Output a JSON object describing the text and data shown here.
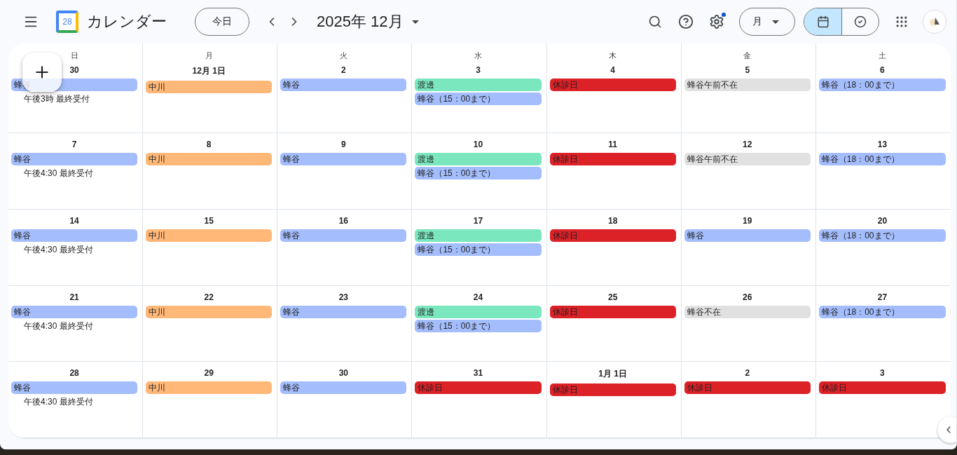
{
  "header": {
    "logo_text": "28",
    "title": "カレンダー",
    "today_button": "今日",
    "period": "2025年 12月",
    "settings_badge": true,
    "view_select": "月",
    "view_toggle": [
      {
        "kind": "calendar",
        "selected": true
      },
      {
        "kind": "tasks",
        "selected": false
      }
    ]
  },
  "weekdays": [
    "日",
    "月",
    "火",
    "水",
    "木",
    "金",
    "土"
  ],
  "weeks": [
    [
      {
        "date": "30",
        "events": [
          {
            "kind": "chip",
            "title": "蜂谷",
            "color": "#a4bdfc"
          },
          {
            "kind": "note",
            "title": "午後3時 最終受付"
          }
        ]
      },
      {
        "date": "12月 1日",
        "events": [
          {
            "kind": "chip",
            "title": "中川",
            "color": "#ffb878"
          }
        ]
      },
      {
        "date": "2",
        "events": [
          {
            "kind": "chip",
            "title": "蜂谷",
            "color": "#a4bdfc"
          }
        ]
      },
      {
        "date": "3",
        "events": [
          {
            "kind": "chip",
            "title": "渡邊",
            "color": "#7ae7bf"
          },
          {
            "kind": "chip",
            "title": "蜂谷（15：00まで）",
            "color": "#a4bdfc"
          }
        ]
      },
      {
        "date": "4",
        "events": [
          {
            "kind": "chip",
            "title": "休診日",
            "color": "#dc2127"
          }
        ]
      },
      {
        "date": "5",
        "events": [
          {
            "kind": "chip",
            "title": "蜂谷午前不在",
            "color": "#e1e1e1"
          }
        ]
      },
      {
        "date": "6",
        "events": [
          {
            "kind": "chip",
            "title": "蜂谷（18：00まで）",
            "color": "#a4bdfc"
          }
        ]
      }
    ],
    [
      {
        "date": "7",
        "events": [
          {
            "kind": "chip",
            "title": "蜂谷",
            "color": "#a4bdfc"
          },
          {
            "kind": "note",
            "title": "午後4:30 最終受付"
          }
        ]
      },
      {
        "date": "8",
        "events": [
          {
            "kind": "chip",
            "title": "中川",
            "color": "#ffb878"
          }
        ]
      },
      {
        "date": "9",
        "events": [
          {
            "kind": "chip",
            "title": "蜂谷",
            "color": "#a4bdfc"
          }
        ]
      },
      {
        "date": "10",
        "events": [
          {
            "kind": "chip",
            "title": "渡邊",
            "color": "#7ae7bf"
          },
          {
            "kind": "chip",
            "title": "蜂谷（15：00まで）",
            "color": "#a4bdfc"
          }
        ]
      },
      {
        "date": "11",
        "events": [
          {
            "kind": "chip",
            "title": "休診日",
            "color": "#dc2127"
          }
        ]
      },
      {
        "date": "12",
        "events": [
          {
            "kind": "chip",
            "title": "蜂谷午前不在",
            "color": "#e1e1e1"
          }
        ]
      },
      {
        "date": "13",
        "events": [
          {
            "kind": "chip",
            "title": "蜂谷（18：00まで）",
            "color": "#a4bdfc"
          }
        ]
      }
    ],
    [
      {
        "date": "14",
        "events": [
          {
            "kind": "chip",
            "title": "蜂谷",
            "color": "#a4bdfc"
          },
          {
            "kind": "note",
            "title": "午後4:30 最終受付"
          }
        ]
      },
      {
        "date": "15",
        "events": [
          {
            "kind": "chip",
            "title": "中川",
            "color": "#ffb878"
          }
        ]
      },
      {
        "date": "16",
        "events": [
          {
            "kind": "chip",
            "title": "蜂谷",
            "color": "#a4bdfc"
          }
        ]
      },
      {
        "date": "17",
        "events": [
          {
            "kind": "chip",
            "title": "渡邊",
            "color": "#7ae7bf"
          },
          {
            "kind": "chip",
            "title": "蜂谷（15：00まで）",
            "color": "#a4bdfc"
          }
        ]
      },
      {
        "date": "18",
        "events": [
          {
            "kind": "chip",
            "title": "休診日",
            "color": "#dc2127"
          }
        ]
      },
      {
        "date": "19",
        "events": [
          {
            "kind": "chip",
            "title": "蜂谷",
            "color": "#a4bdfc"
          }
        ]
      },
      {
        "date": "20",
        "events": [
          {
            "kind": "chip",
            "title": "蜂谷（18：00まで）",
            "color": "#a4bdfc"
          }
        ]
      }
    ],
    [
      {
        "date": "21",
        "events": [
          {
            "kind": "chip",
            "title": "蜂谷",
            "color": "#a4bdfc"
          },
          {
            "kind": "note",
            "title": "午後4:30 最終受付"
          }
        ]
      },
      {
        "date": "22",
        "events": [
          {
            "kind": "chip",
            "title": "中川",
            "color": "#ffb878"
          }
        ]
      },
      {
        "date": "23",
        "events": [
          {
            "kind": "chip",
            "title": "蜂谷",
            "color": "#a4bdfc"
          }
        ]
      },
      {
        "date": "24",
        "events": [
          {
            "kind": "chip",
            "title": "渡邊",
            "color": "#7ae7bf"
          },
          {
            "kind": "chip",
            "title": "蜂谷（15：00まで）",
            "color": "#a4bdfc"
          }
        ]
      },
      {
        "date": "25",
        "events": [
          {
            "kind": "chip",
            "title": "休診日",
            "color": "#dc2127"
          }
        ]
      },
      {
        "date": "26",
        "events": [
          {
            "kind": "chip",
            "title": "蜂谷不在",
            "color": "#e1e1e1"
          }
        ]
      },
      {
        "date": "27",
        "events": [
          {
            "kind": "chip",
            "title": "蜂谷（18：00まで）",
            "color": "#a4bdfc"
          }
        ]
      }
    ],
    [
      {
        "date": "28",
        "events": [
          {
            "kind": "chip",
            "title": "蜂谷",
            "color": "#a4bdfc"
          },
          {
            "kind": "note",
            "title": "午後4:30 最終受付"
          }
        ]
      },
      {
        "date": "29",
        "events": [
          {
            "kind": "chip",
            "title": "中川",
            "color": "#ffb878"
          }
        ]
      },
      {
        "date": "30",
        "events": [
          {
            "kind": "chip",
            "title": "蜂谷",
            "color": "#a4bdfc"
          }
        ]
      },
      {
        "date": "31",
        "events": [
          {
            "kind": "chip",
            "title": "休診日",
            "color": "#dc2127"
          }
        ]
      },
      {
        "date": "1月 1日",
        "events": [
          {
            "kind": "chip",
            "title": "休診日",
            "color": "#dc2127"
          }
        ]
      },
      {
        "date": "2",
        "events": [
          {
            "kind": "chip",
            "title": "休診日",
            "color": "#dc2127"
          }
        ]
      },
      {
        "date": "3",
        "events": [
          {
            "kind": "chip",
            "title": "休診日",
            "color": "#dc2127"
          }
        ]
      }
    ]
  ]
}
